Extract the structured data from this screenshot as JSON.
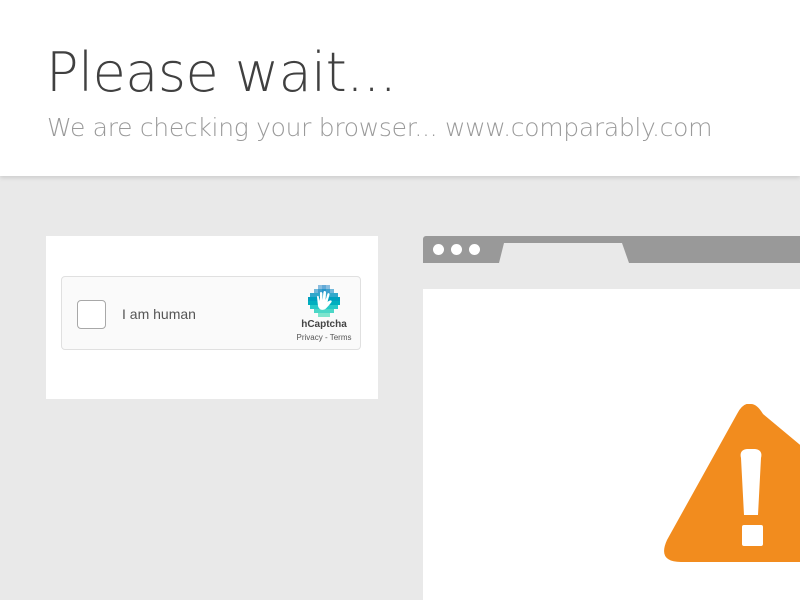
{
  "header": {
    "title": "Please wait...",
    "subtitle": "We are checking your browser... www.comparably.com"
  },
  "captcha": {
    "checkbox_label": "I am human",
    "brand": "hCaptcha",
    "privacy_link": "Privacy",
    "separator": " - ",
    "terms_link": "Terms",
    "logo_icon": "hcaptcha-hand-icon"
  },
  "illustration": {
    "warning_icon": "warning-triangle-icon",
    "warning_color": "#f28c1e"
  },
  "colors": {
    "page_background": "#e9e9e9",
    "title_text": "#404040",
    "subtitle_text": "#9a9a9a",
    "browser_chrome": "#999999"
  }
}
